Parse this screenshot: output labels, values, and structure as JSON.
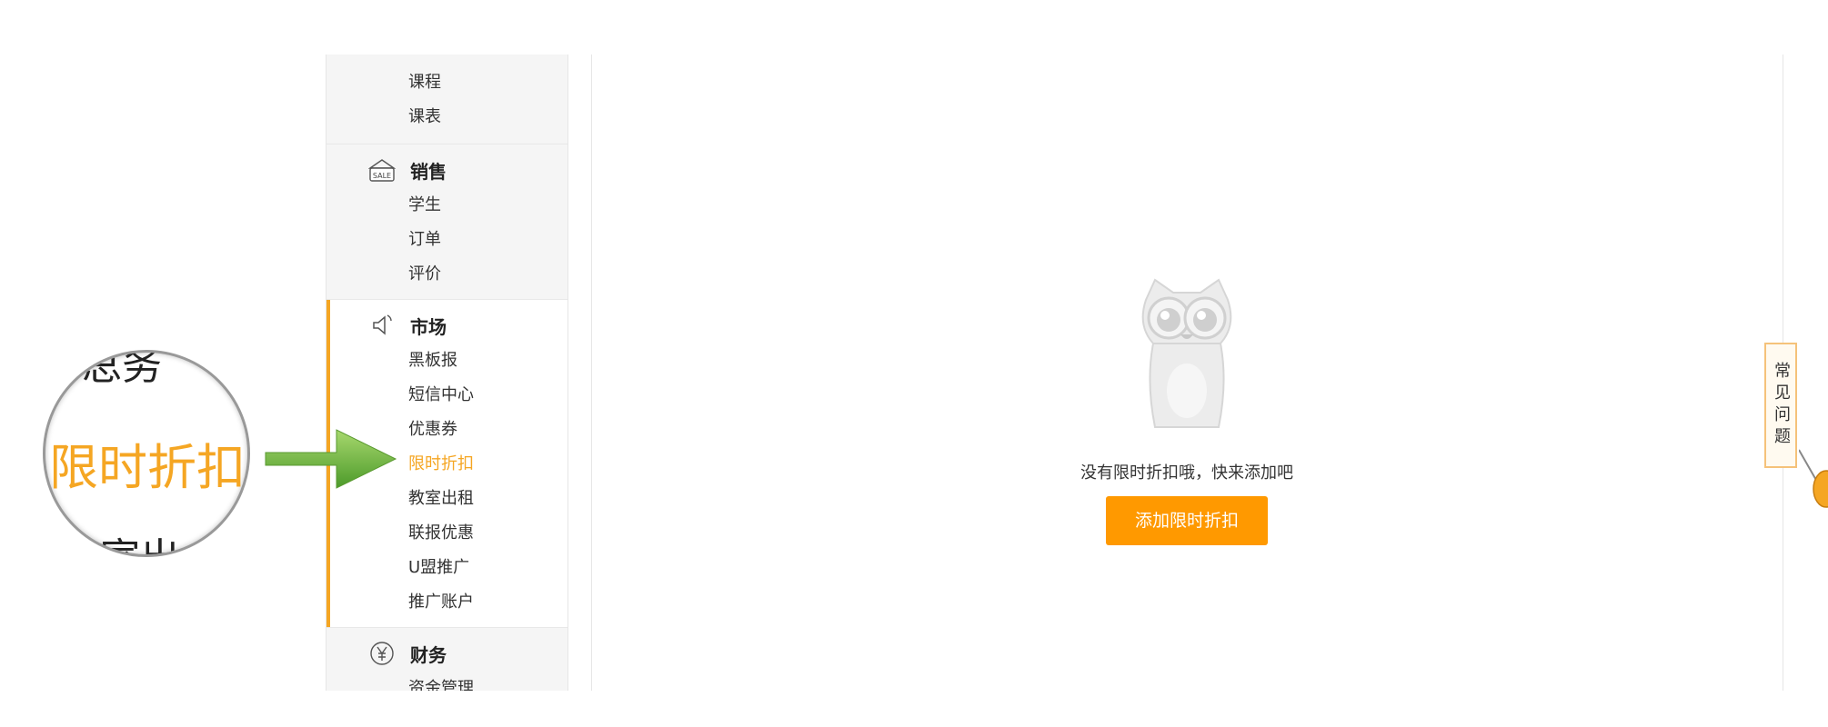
{
  "sidebar": {
    "groups": [
      {
        "title": "",
        "items": [
          "课程",
          "课表"
        ]
      },
      {
        "title": "销售",
        "icon": "sale-icon",
        "icon_text": "SALE",
        "items": [
          "学生",
          "订单",
          "评价"
        ]
      },
      {
        "title": "市场",
        "icon": "megaphone-icon",
        "items": [
          "黑板报",
          "短信中心",
          "优惠券",
          "限时折扣",
          "教室出租",
          "联报优惠",
          "U盟推广",
          "推广账户"
        ],
        "active_item": "限时折扣"
      },
      {
        "title": "财务",
        "icon": "yen-icon",
        "items": [
          "资金管理"
        ]
      }
    ]
  },
  "magnifier": {
    "top_text": "总务",
    "main_text": "限时折扣",
    "bottom_text": "室出"
  },
  "empty_state": {
    "message": "没有限时折扣哦，快来添加吧",
    "button_label": "添加限时折扣",
    "illustration": "owl-icon"
  },
  "faq_tab": {
    "label": "常见问题"
  },
  "colors": {
    "accent": "#f5a623",
    "button": "#ff9900",
    "arrow": "#6db33f"
  }
}
